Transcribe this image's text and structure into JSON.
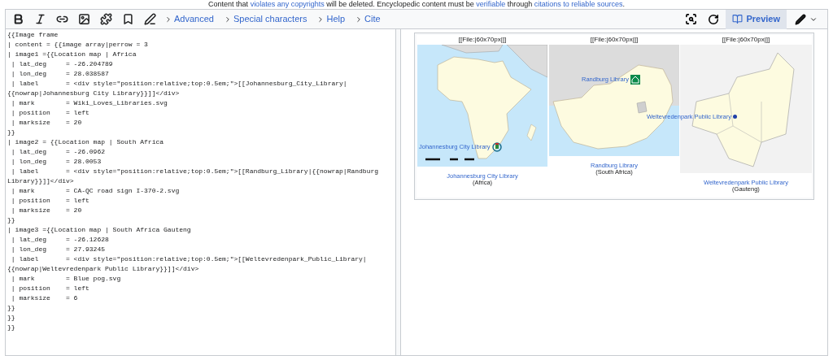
{
  "notice": [
    {
      "text": "Content that ",
      "link": false
    },
    {
      "text": "violates any copyrights",
      "link": true
    },
    {
      "text": " will be deleted. Encyclopedic content must be ",
      "link": false
    },
    {
      "text": "verifiable",
      "link": true
    },
    {
      "text": " through ",
      "link": false
    },
    {
      "text": "citations to reliable sources",
      "link": true
    },
    {
      "text": ".",
      "link": false
    }
  ],
  "toolbar": {
    "tools": [
      {
        "kind": "bold"
      },
      {
        "kind": "italic"
      },
      {
        "kind": "link"
      },
      {
        "kind": "image"
      },
      {
        "kind": "template"
      },
      {
        "kind": "bookmark"
      },
      {
        "kind": "signature"
      }
    ],
    "groups": [
      {
        "label": "Advanced",
        "selected": false
      },
      {
        "label": "Special characters",
        "selected": false
      },
      {
        "label": "Help",
        "selected": false
      },
      {
        "label": "Cite",
        "selected": false
      }
    ],
    "right": [
      {
        "kind": "search"
      },
      {
        "kind": "refresh"
      },
      {
        "kind": "preview",
        "label": "Preview",
        "selected": true
      },
      {
        "kind": "pen"
      }
    ]
  },
  "editor": {
    "lines": [
      "{{Image frame",
      "| content = {{image array|perrow = 3",
      "| image1 ={{Location map | Africa",
      " | lat_deg     = -26.204789",
      " | lon_deg     = 28.038587",
      " | label       = <div style=\"position:relative;top:0.5em;\">[[Johannesburg_City_Library|",
      "{{nowrap|Johannesburg City Library}}]]</div>",
      " | mark        = Wiki_Loves_Libraries.svg",
      " | position    = left",
      " | marksize    = 20",
      "}}",
      "| image2 = {{Location map | South Africa",
      " | lat_deg     = -26.0962",
      " | lon_deg     = 28.0053",
      " | label       = <div style=\"position:relative;top:0.5em;\">[[Randburg_Library|{{nowrap|Randburg",
      "Library}}]]</div>",
      " | mark        = CA-QC road sign I-370-2.svg",
      " | position    = left",
      " | marksize    = 20",
      "}}",
      "| image3 ={{Location map | South Africa Gauteng",
      " | lat_deg     = -26.12628",
      " | lon_deg     = 27.93245",
      " | label       = <div style=\"position:relative;top:0.5em;\">[[Weltevredenpark_Public_Library|",
      "{{nowrap|Weltevredenpark Public Library}}]]</div>",
      " | mark        = Blue pog.svg",
      " | position    = left",
      " | marksize    = 6",
      "}}",
      "}}",
      "}}"
    ]
  },
  "preview": {
    "maps": [
      {
        "kind": "africa",
        "heading": "[[File:|60x70px|]]",
        "map_label": "Johannesburg City Library",
        "caption_link": "Johannesburg City Library",
        "caption_region": "(Africa)"
      },
      {
        "kind": "south_africa",
        "heading": "[[File:|60x70px|]]",
        "map_label": "Randburg Library",
        "caption_link": "Randburg Library",
        "caption_region": "(South Africa)"
      },
      {
        "kind": "gauteng",
        "heading": "[[File:|60x70px|]]",
        "map_label": "Weltevredenpark Public Library",
        "caption_link": "Weltevredenpark Public Library",
        "caption_region": "(Gauteng)"
      }
    ]
  }
}
